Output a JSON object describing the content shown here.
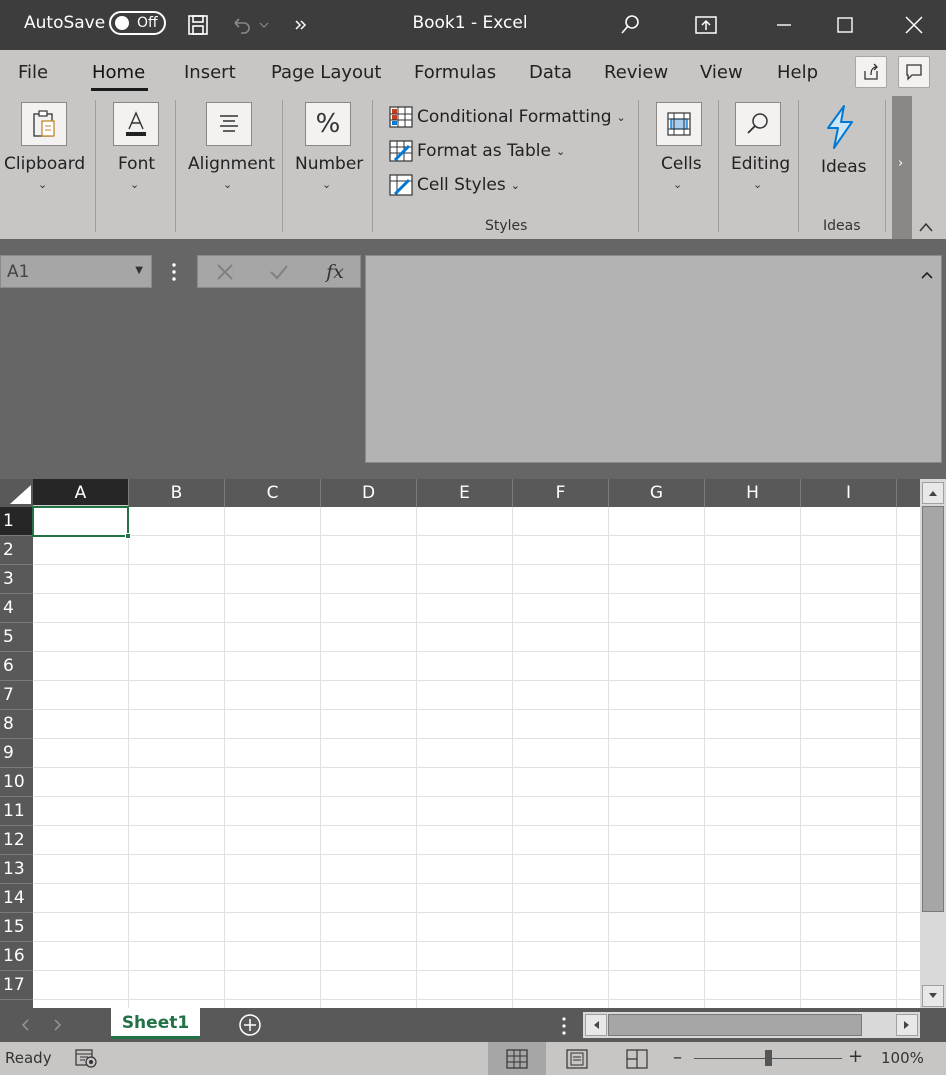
{
  "titlebar": {
    "autosave_label": "AutoSave",
    "autosave_state": "Off",
    "title": "Book1  -  Excel"
  },
  "tabs": [
    "File",
    "Home",
    "Insert",
    "Page Layout",
    "Formulas",
    "Data",
    "Review",
    "View",
    "Help"
  ],
  "active_tab": "Home",
  "ribbon": {
    "clipboard": "Clipboard",
    "font": "Font",
    "alignment": "Alignment",
    "number": "Number",
    "conditional_formatting": "Conditional Formatting",
    "format_as_table": "Format as Table",
    "cell_styles": "Cell Styles",
    "styles_group": "Styles",
    "cells": "Cells",
    "editing": "Editing",
    "ideas": "Ideas",
    "ideas_group": "Ideas"
  },
  "formula_bar": {
    "name_box": "A1",
    "fx": "fx",
    "value": ""
  },
  "grid": {
    "columns": [
      "A",
      "B",
      "C",
      "D",
      "E",
      "F",
      "G",
      "H",
      "I"
    ],
    "rows": [
      "1",
      "2",
      "3",
      "4",
      "5",
      "6",
      "7",
      "8",
      "9",
      "10",
      "11",
      "12",
      "13",
      "14",
      "15",
      "16",
      "17"
    ],
    "selected_cell": "A1"
  },
  "sheets": {
    "active": "Sheet1"
  },
  "statusbar": {
    "ready": "Ready",
    "zoom": "100%",
    "zoom_fraction": 0.5
  },
  "colors": {
    "excel_green": "#217346",
    "ribbon_bg": "#c8c6c4",
    "titlebar_bg": "#3d3d3d",
    "ideas_blue": "#0078d4"
  }
}
